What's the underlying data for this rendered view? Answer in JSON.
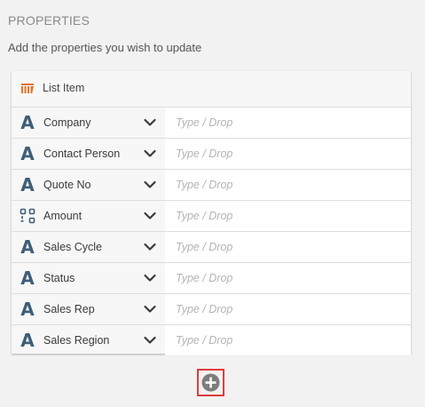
{
  "section": {
    "title": "PROPERTIES",
    "subtitle": "Add the properties you wish to update"
  },
  "card": {
    "header_label": "List Item",
    "header_icon": "list-item-icon"
  },
  "properties": [
    {
      "label": "Company",
      "type_icon": "text-type-icon",
      "placeholder": "Type / Drop"
    },
    {
      "label": "Contact Person",
      "type_icon": "text-type-icon",
      "placeholder": "Type / Drop"
    },
    {
      "label": "Quote No",
      "type_icon": "text-type-icon",
      "placeholder": "Type / Drop"
    },
    {
      "label": "Amount",
      "type_icon": "number-type-icon",
      "placeholder": "Type / Drop"
    },
    {
      "label": "Sales Cycle",
      "type_icon": "text-type-icon",
      "placeholder": "Type / Drop"
    },
    {
      "label": "Status",
      "type_icon": "text-type-icon",
      "placeholder": "Type / Drop"
    },
    {
      "label": "Sales Rep",
      "type_icon": "text-type-icon",
      "placeholder": "Type / Drop"
    },
    {
      "label": "Sales Region",
      "type_icon": "text-type-icon",
      "placeholder": "Type / Drop"
    }
  ],
  "text_glyph": "A",
  "add_button": {
    "icon": "plus-circle-icon"
  },
  "colors": {
    "type_icon": "#3e5e78",
    "list_icon": "#e2762a",
    "highlight_border": "#e03c3c",
    "plus_circle": "#7d7d7d"
  }
}
